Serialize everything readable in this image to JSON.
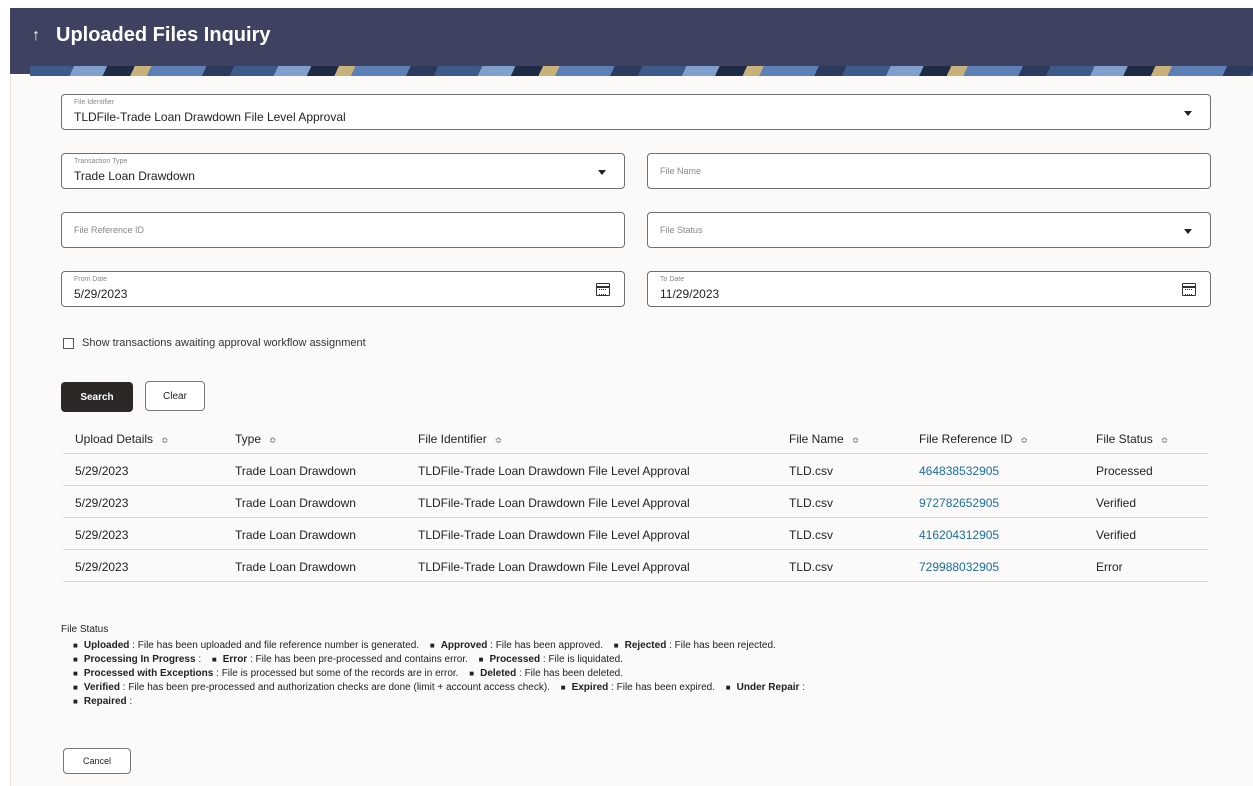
{
  "header": {
    "title": "Uploaded Files Inquiry"
  },
  "form": {
    "file_identifier": {
      "label": "File Identifier",
      "value": "TLDFile-Trade Loan Drawdown File Level Approval"
    },
    "transaction_type": {
      "label": "Transaction Type",
      "value": "Trade Loan Drawdown"
    },
    "file_name": {
      "placeholder": "File Name"
    },
    "file_reference_id": {
      "placeholder": "File Reference ID"
    },
    "file_status": {
      "placeholder": "File Status"
    },
    "from_date": {
      "label": "From Date",
      "value": "5/29/2023"
    },
    "to_date": {
      "label": "To Date",
      "value": "11/29/2023"
    },
    "checkbox_label": "Show transactions awaiting approval workflow assignment",
    "search_label": "Search",
    "clear_label": "Clear"
  },
  "table": {
    "columns": [
      "Upload Details",
      "Type",
      "File Identifier",
      "File Name",
      "File Reference ID",
      "File Status"
    ],
    "rows": [
      [
        "5/29/2023",
        "Trade Loan Drawdown",
        "TLDFile-Trade Loan Drawdown File Level Approval",
        "TLD.csv",
        "464838532905",
        "Processed"
      ],
      [
        "5/29/2023",
        "Trade Loan Drawdown",
        "TLDFile-Trade Loan Drawdown File Level Approval",
        "TLD.csv",
        "972782652905",
        "Verified"
      ],
      [
        "5/29/2023",
        "Trade Loan Drawdown",
        "TLDFile-Trade Loan Drawdown File Level Approval",
        "TLD.csv",
        "416204312905",
        "Verified"
      ],
      [
        "5/29/2023",
        "Trade Loan Drawdown",
        "TLDFile-Trade Loan Drawdown File Level Approval",
        "TLD.csv",
        "729988032905",
        "Error"
      ]
    ]
  },
  "legend": {
    "title": "File Status",
    "items": [
      {
        "term": "Uploaded",
        "desc": "File has been uploaded and file reference number is generated."
      },
      {
        "term": "Approved",
        "desc": "File has been approved."
      },
      {
        "term": "Rejected",
        "desc": "File has been rejected."
      },
      {
        "term": "Processing In Progress",
        "desc": ""
      },
      {
        "term": "Error",
        "desc": "File has been pre-processed and contains error."
      },
      {
        "term": "Processed",
        "desc": "File is liquidated."
      },
      {
        "term": "Processed with Exceptions",
        "desc": "File is processed but some of the records are in error."
      },
      {
        "term": "Deleted",
        "desc": "File has been deleted."
      },
      {
        "term": "Verified",
        "desc": "File has been pre-processed and authorization checks are done (limit + account access check)."
      },
      {
        "term": "Expired",
        "desc": "File has been expired."
      },
      {
        "term": "Under Repair",
        "desc": ""
      },
      {
        "term": "Repaired",
        "desc": ""
      }
    ]
  },
  "footer": {
    "cancel_label": "Cancel"
  }
}
